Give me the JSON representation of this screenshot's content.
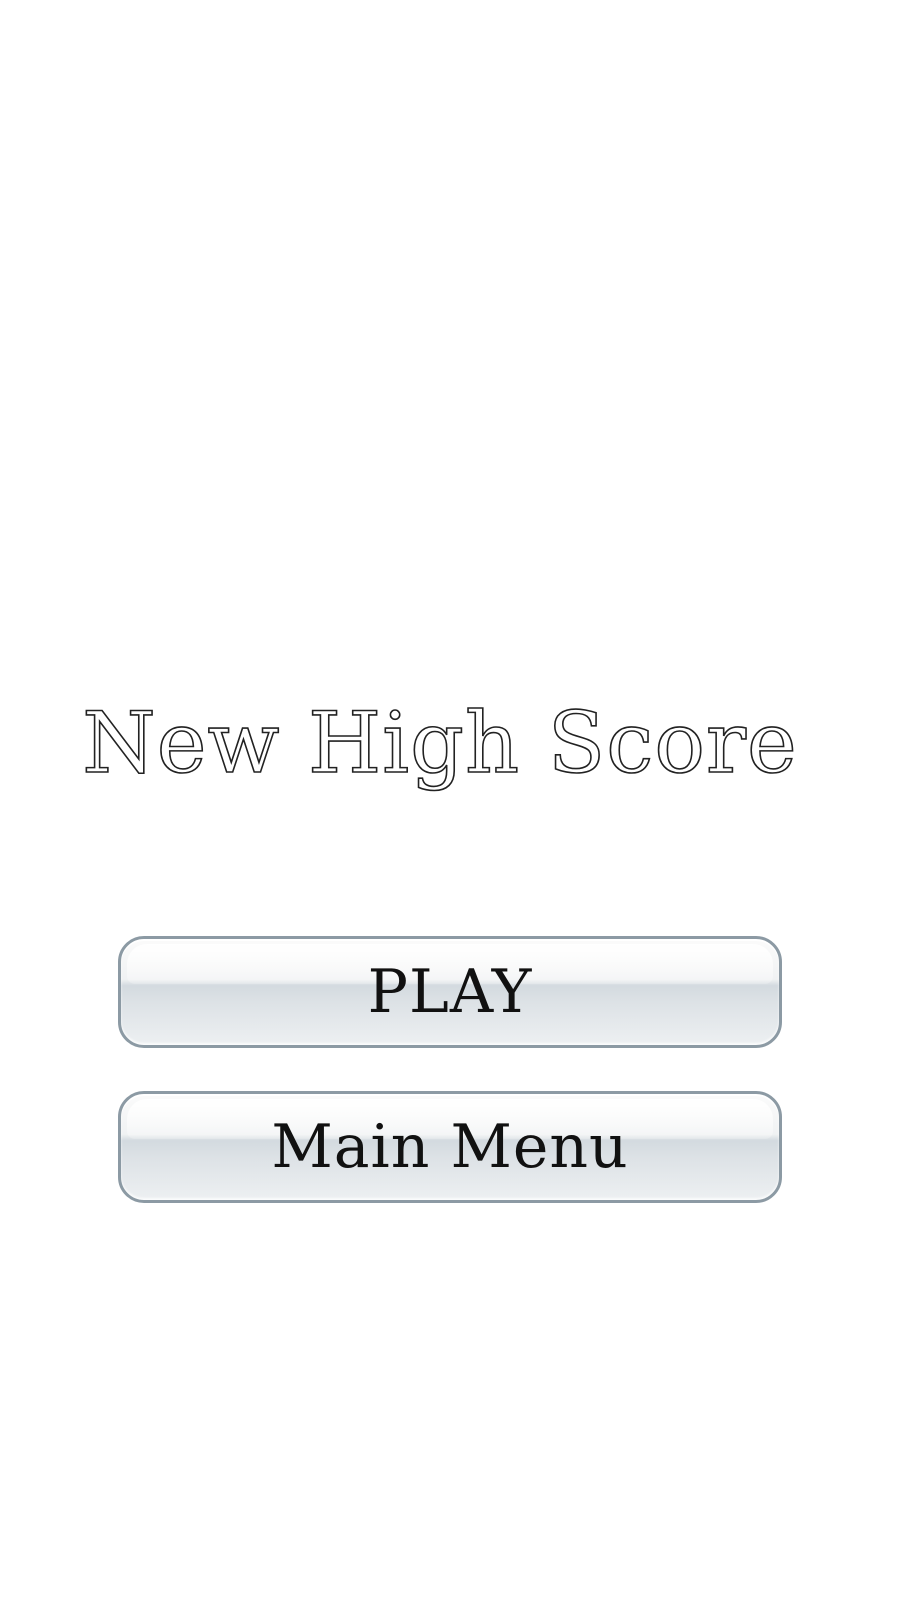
{
  "screen": {
    "title": "New High Score"
  },
  "buttons": {
    "play_label": "PLAY",
    "main_menu_label": "Main Menu"
  },
  "colors": {
    "background": "#ffffff",
    "button_border": "#8c9aa4",
    "text": "#111111"
  }
}
